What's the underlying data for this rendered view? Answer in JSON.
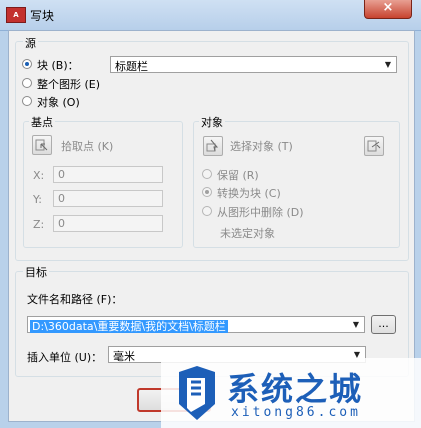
{
  "window": {
    "title": "写块",
    "close_label": "×",
    "app_icon": "A",
    "app_icon_name": "autocad-icon"
  },
  "source": {
    "group_label": "源",
    "options": [
      {
        "label": "块 (B)：",
        "selected": true
      },
      {
        "label": "整个图形 (E)",
        "selected": false
      },
      {
        "label": "对象 (O)",
        "selected": false
      }
    ],
    "block_name": "标题栏"
  },
  "base_point": {
    "group_label": "基点",
    "pick_label": "拾取点 (K)",
    "x_label": "X:",
    "x_value": "0",
    "y_label": "Y:",
    "y_value": "0",
    "z_label": "Z:",
    "z_value": "0"
  },
  "objects": {
    "group_label": "对象",
    "select_label": "选择对象 (T)",
    "options": [
      {
        "label": "保留 (R)",
        "selected": false
      },
      {
        "label": "转换为块 (C)",
        "selected": true
      },
      {
        "label": "从图形中删除 (D)",
        "selected": false
      }
    ],
    "status": "未选定对象"
  },
  "target": {
    "group_label": "目标",
    "path_label": "文件名和路径 (F)：",
    "path_value": "D:\\360data\\重要数据\\我的文档\\标题栏",
    "browse_label": "...",
    "units_label": "插入单位 (U)：",
    "units_value": "毫米"
  },
  "watermark": {
    "brand": "系统之城",
    "url": "xitong86.com"
  },
  "colors": {
    "selection": "#3399ff",
    "title_bar": "#b9d1ea",
    "watermark_blue": "#1d5fb8"
  }
}
